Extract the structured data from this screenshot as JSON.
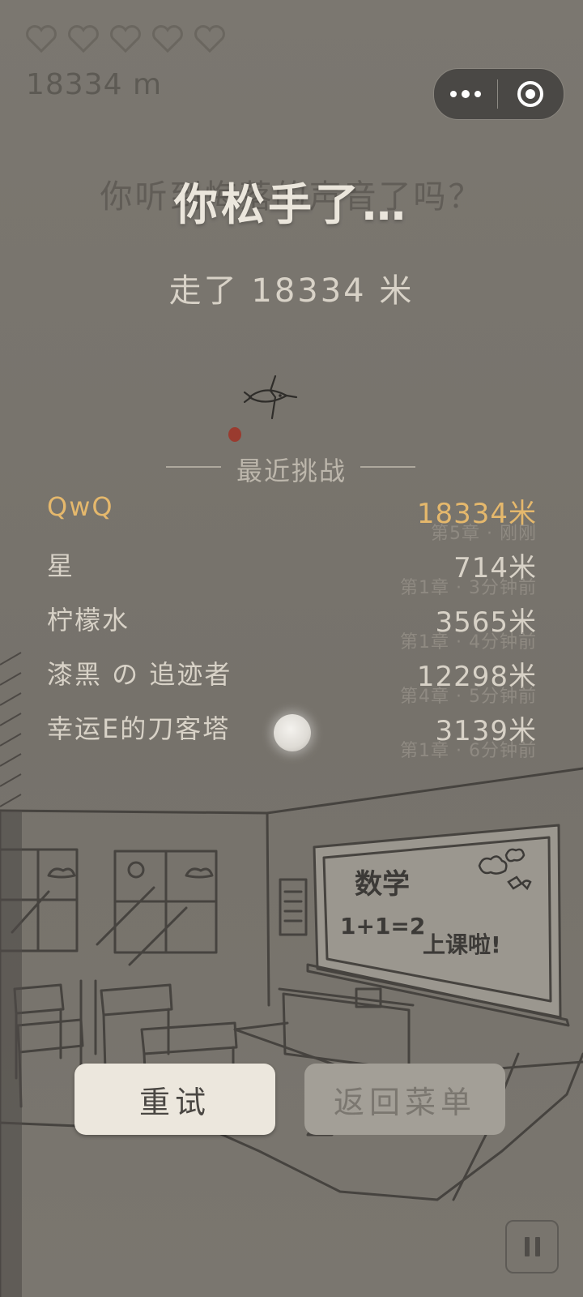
{
  "hud": {
    "hearts": 5,
    "distance_label": "18334 m"
  },
  "capsule": {
    "more_icon": "more-dots-icon",
    "close_icon": "close-target-icon"
  },
  "result": {
    "hint": "你听到悔落的声音了吗？",
    "headline": "你松手了…",
    "walked": "走了 18334 米"
  },
  "recent": {
    "title": "最近挑战",
    "entries": [
      {
        "name": "QwQ",
        "distance": "18334米",
        "meta": "第5章 · 刚刚",
        "is_me": true
      },
      {
        "name": "星",
        "distance": "714米",
        "meta": "第1章 · 3分钟前",
        "is_me": false
      },
      {
        "name": "柠檬水",
        "distance": "3565米",
        "meta": "第1章 · 4分钟前",
        "is_me": false
      },
      {
        "name": "漆黑 の 追迹者",
        "distance": "12298米",
        "meta": "第4章 · 5分钟前",
        "is_me": false
      },
      {
        "name": "幸运E的刀客塔",
        "distance": "3139米",
        "meta": "第1章 · 6分钟前",
        "is_me": false
      }
    ]
  },
  "scene": {
    "board_subject": "数学",
    "board_equation": "1+1=2",
    "board_note": "上课啦!"
  },
  "buttons": {
    "retry": "重试",
    "menu": "返回菜单",
    "pause_icon": "pause-icon"
  },
  "colors": {
    "highlight": "#e5b86c",
    "text_light": "#d8d2c7",
    "background": "#76726b"
  }
}
